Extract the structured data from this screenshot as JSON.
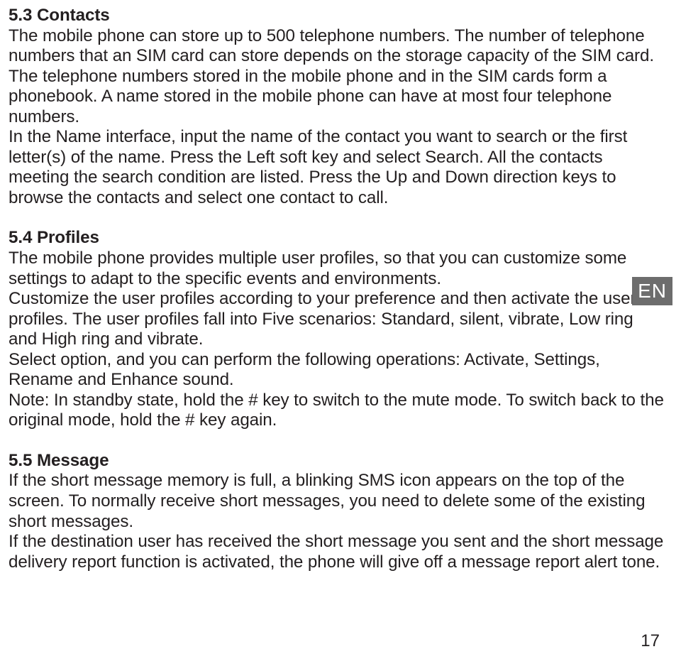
{
  "langTab": "EN",
  "pageNumber": "17",
  "sections": {
    "s1": {
      "heading": "5.3 Contacts",
      "body": "The mobile phone can store up to 500 telephone numbers. The number of te­lephone numbers that an SIM card can store depends on the storage capacity of the SIM card. The telephone numbers stored in the mobile phone and in the SIM cards form a phonebook. A name stored in the mobile phone can have at most four telephone numbers.\nIn the Name interface, input the name of the contact you want to search or the first letter(s) of the name. Press the Left soft key and select Search. All the contacts meeting the search condition are listed. Press the Up and Down di­rection keys to browse the contacts and select one contact to call."
    },
    "s2": {
      "heading": "5.4 Profiles",
      "body": "The mobile phone provides multiple user profiles, so that you can customize some settings to adapt to the specific events and environments.\nCustomize the user profiles according to your preference and then activate the user profiles. The user profiles fall into Five scenarios: Standard, silent, vibra­te, Low ring and High ring and vibrate.\nSelect option, and you can perform the following operations: Activate, Settings, Rename and Enhance sound.\nNote: In standby state, hold the # key to switch to the mute mode. To switch back to the original mode, hold the # key again."
    },
    "s3": {
      "heading": "5.5 Message",
      "body": "If the short message memory is full, a blinking SMS icon appears on the top of the screen. To normally receive short messages, you need to delete some of the existing short messages.\nIf the destination user has received the short message you sent and the short message delivery report function is activated, the phone will give off a messa­ge report alert tone."
    }
  }
}
